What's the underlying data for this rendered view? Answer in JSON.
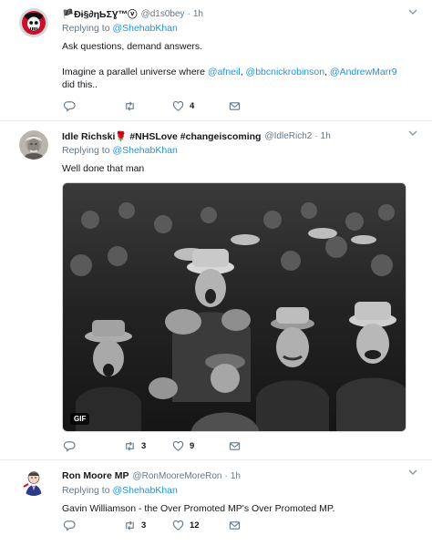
{
  "tweets": [
    {
      "name": "🏴Đɨ§∂ηƄΣƔ™ⓥ",
      "handle": "@d1s0bey",
      "dot": "·",
      "time": "1h",
      "replying_prefix": "Replying to ",
      "replying_to": "@ShehabKhan",
      "text_line1": "Ask questions, demand answers.",
      "text_line2_prefix": "Imagine a parallel universe where ",
      "mention1": "@afneil",
      "sep1": ", ",
      "mention2": "@bbcnickrobinson",
      "sep2": ", ",
      "mention3": "@AndrewMarr9",
      "text_line3": "did this..",
      "reply_count": "",
      "retweet_count": "",
      "like_count": "4",
      "avatar_icon": "skull-avatar"
    },
    {
      "name": "Idle Richski🌹 #NHSLove #changeiscoming",
      "handle": "@IdleRich2",
      "dot": "·",
      "time": "1h",
      "replying_prefix": "Replying to ",
      "replying_to": "@ShehabKhan",
      "text_line1": "Well done that man",
      "gif_label": "GIF",
      "reply_count": "",
      "retweet_count": "3",
      "like_count": "9",
      "avatar_icon": "portrait-avatar"
    },
    {
      "name": "Ron Moore MP",
      "handle": "@RonMooreMoreRon",
      "dot": "·",
      "time": "1h",
      "replying_prefix": "Replying to ",
      "replying_to": "@ShehabKhan",
      "text_line1": "Gavin Williamson - the Over Promoted MP's Over Promoted MP.",
      "reply_count": "",
      "retweet_count": "3",
      "like_count": "12",
      "avatar_icon": "cartoon-avatar"
    }
  ],
  "icons": {
    "reply": "reply-icon",
    "retweet": "retweet-icon",
    "like": "heart-icon",
    "dm": "envelope-icon",
    "caret": "chevron-down-icon"
  },
  "colors": {
    "link": "#1b95e0",
    "muted": "#657786",
    "divider": "#e6ecf0"
  }
}
